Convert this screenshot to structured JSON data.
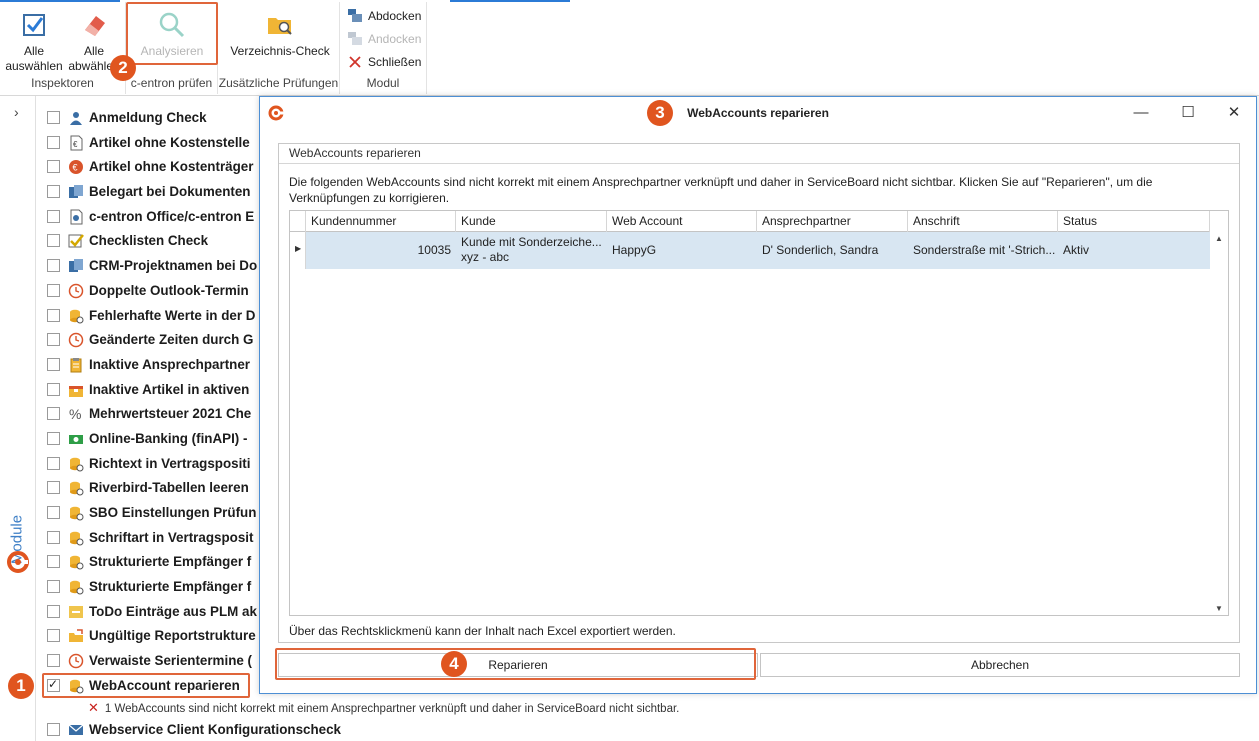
{
  "ribbon": {
    "select_all_label": "Alle auswählen",
    "deselect_all_label": "Alle abwählen",
    "analyze_label": "Analysieren",
    "dircheck_label": "Verzeichnis-Check",
    "undock_label": "Abdocken",
    "dock_label": "Andocken",
    "close_label": "Schließen",
    "groups": {
      "inspectors": "Inspektoren",
      "centron": "c-entron prüfen",
      "additional": "Zusätzliche Prüfungen",
      "module": "Modul"
    }
  },
  "callouts": {
    "one": "1",
    "two": "2",
    "three": "3",
    "four": "4"
  },
  "sidebar": {
    "label": "Module"
  },
  "inspectors": [
    {
      "label": "Anmeldung Check",
      "icon": "user-icon",
      "checked": false
    },
    {
      "label": "Artikel ohne Kostenstelle",
      "icon": "document-euro-icon",
      "checked": false
    },
    {
      "label": "Artikel ohne Kostenträger",
      "icon": "euro-coin-icon",
      "checked": false
    },
    {
      "label": "Belegart bei Dokumenten",
      "icon": "copy-icon",
      "checked": false
    },
    {
      "label": "c-entron Office/c-entron E",
      "icon": "document-icon",
      "checked": false
    },
    {
      "label": "Checklisten Check",
      "icon": "checkmark-icon",
      "checked": false
    },
    {
      "label": "CRM-Projektnamen bei Do",
      "icon": "copy-icon",
      "checked": false
    },
    {
      "label": "Doppelte Outlook-Termin",
      "icon": "clock-icon",
      "checked": false
    },
    {
      "label": "Fehlerhafte Werte in der D",
      "icon": "database-icon",
      "checked": false
    },
    {
      "label": "Geänderte Zeiten durch G",
      "icon": "clock-icon",
      "checked": false
    },
    {
      "label": "Inaktive Ansprechpartner",
      "icon": "clipboard-icon",
      "checked": false
    },
    {
      "label": "Inaktive Artikel in aktiven",
      "icon": "package-icon",
      "checked": false
    },
    {
      "label": "Mehrwertsteuer 2021 Che",
      "icon": "percent-icon",
      "checked": false
    },
    {
      "label": "Online-Banking (finAPI) -",
      "icon": "money-icon",
      "checked": false
    },
    {
      "label": "Richtext in Vertragspositi",
      "icon": "database-icon",
      "checked": false
    },
    {
      "label": "Riverbird-Tabellen leeren",
      "icon": "database-icon",
      "checked": false
    },
    {
      "label": "SBO Einstellungen Prüfun",
      "icon": "database-icon",
      "checked": false
    },
    {
      "label": "Schriftart in Vertragsposit",
      "icon": "database-icon",
      "checked": false
    },
    {
      "label": "Strukturierte Empfänger f",
      "icon": "database-icon",
      "checked": false
    },
    {
      "label": "Strukturierte Empfänger f",
      "icon": "database-icon",
      "checked": false
    },
    {
      "label": "ToDo Einträge aus PLM ak",
      "icon": "note-icon",
      "checked": false
    },
    {
      "label": "Ungültige Reportstrukture",
      "icon": "folder-icon",
      "checked": false
    },
    {
      "label": "Verwaiste Serientermine (",
      "icon": "clock-icon",
      "checked": false
    },
    {
      "label": "WebAccount reparieren",
      "icon": "database-icon",
      "checked": true
    }
  ],
  "result_line": "1 WebAccounts sind nicht korrekt mit einem Ansprechpartner verknüpft und daher in ServiceBoard nicht sichtbar.",
  "last_item": {
    "label": "Webservice Client Konfigurationscheck",
    "icon": "mail-icon"
  },
  "dialog": {
    "title": "WebAccounts reparieren",
    "group_title": "WebAccounts reparieren",
    "description": "Die folgenden WebAccounts sind nicht korrekt mit einem Ansprechpartner verknüpft und daher in ServiceBoard nicht sichtbar. Klicken Sie auf \"Reparieren\", um die Verknüpfungen zu korrigieren.",
    "columns": [
      "Kundennummer",
      "Kunde",
      "Web Account",
      "Ansprechpartner",
      "Anschrift",
      "Status"
    ],
    "row": {
      "kundennummer": "10035",
      "kunde_line1": "Kunde mit Sonderzeiche...",
      "kunde_line2": "xyz - abc",
      "web_account": "HappyG",
      "ansprechpartner": "D' Sonderlich, Sandra",
      "anschrift": "Sonderstraße mit '-Strich...",
      "status": "Aktiv"
    },
    "footnote": "Über das Rechtsklickmenü kann der Inhalt nach Excel exportiert werden.",
    "repair_label": "Reparieren",
    "cancel_label": "Abbrechen"
  },
  "colors": {
    "accent": "#2b7bd6",
    "callout": "#e0551f",
    "selection": "#d8e6f2",
    "error": "#c8231f"
  }
}
